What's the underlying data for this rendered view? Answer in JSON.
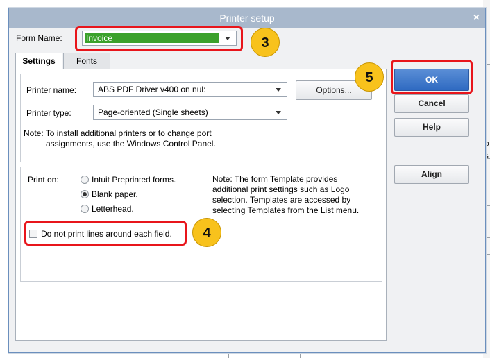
{
  "dialog": {
    "title": "Printer setup",
    "close_label": "×"
  },
  "form_name": {
    "label": "Form Name:",
    "value": "Invoice"
  },
  "tabs": [
    {
      "label": "Settings",
      "active": true
    },
    {
      "label": "Fonts",
      "active": false
    }
  ],
  "printer": {
    "name_label": "Printer name:",
    "name_value": "ABS PDF Driver v400 on nul:",
    "type_label": "Printer type:",
    "type_value": "Page-oriented (Single sheets)",
    "options_button": "Options...",
    "note_line1": "Note: To install additional printers or to change port",
    "note_line2": "assignments, use the Windows Control Panel."
  },
  "print_on": {
    "label": "Print on:",
    "options": [
      {
        "label": "Intuit Preprinted forms.",
        "selected": false
      },
      {
        "label": "Blank paper.",
        "selected": true
      },
      {
        "label": "Letterhead.",
        "selected": false
      }
    ],
    "note_lines": [
      "Note: The form Template provides",
      "additional print settings such as Logo",
      "selection.  Templates are accessed by",
      "selecting Templates from the List menu."
    ]
  },
  "no_lines_checkbox": {
    "label": "Do not print lines around each field.",
    "checked": false
  },
  "buttons": {
    "ok": "OK",
    "cancel": "Cancel",
    "help": "Help",
    "align": "Align"
  },
  "callouts": [
    "3",
    "4",
    "5"
  ],
  "background_fragments": [
    "o",
    "s"
  ],
  "colors": {
    "accent_red": "#e8151b",
    "callout_yellow": "#f8c21c",
    "form_name_highlight": "#3ba12b",
    "ok_blue": "#2f6ac1"
  }
}
